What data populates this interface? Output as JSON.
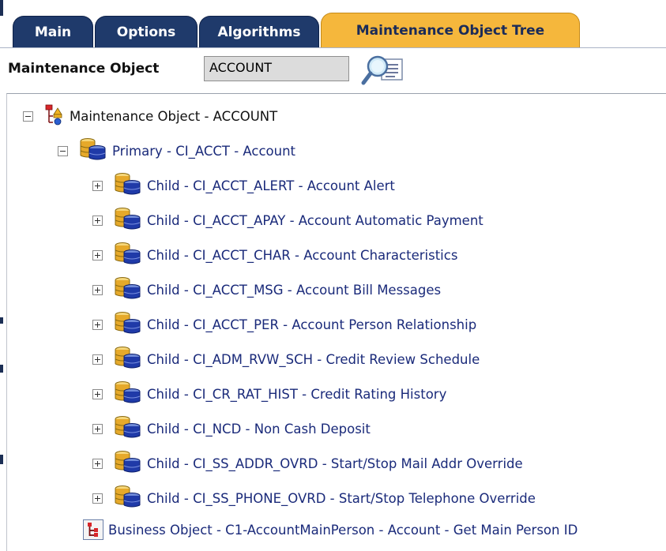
{
  "tabs": [
    {
      "label": "Main",
      "active": false
    },
    {
      "label": "Options",
      "active": false
    },
    {
      "label": "Algorithms",
      "active": false
    },
    {
      "label": "Maintenance Object Tree",
      "active": true
    }
  ],
  "maintenance_object": {
    "label": "Maintenance Object",
    "value": "ACCOUNT",
    "search_icon": "search-magnifier-icon"
  },
  "tree": {
    "root": {
      "label": "Maintenance Object - ACCOUNT",
      "icon": "maintenance-object-icon",
      "expanded": true
    },
    "primary": {
      "label": "Primary - CI_ACCT - Account",
      "icon": "database-table-icon",
      "expanded": true
    },
    "children": [
      {
        "label": "Child - CI_ACCT_ALERT - Account Alert"
      },
      {
        "label": "Child - CI_ACCT_APAY - Account Automatic Payment"
      },
      {
        "label": "Child - CI_ACCT_CHAR - Account Characteristics"
      },
      {
        "label": "Child - CI_ACCT_MSG - Account Bill Messages"
      },
      {
        "label": "Child - CI_ACCT_PER - Account Person Relationship"
      },
      {
        "label": "Child - CI_ADM_RVW_SCH - Credit Review Schedule"
      },
      {
        "label": "Child - CI_CR_RAT_HIST - Credit Rating History"
      },
      {
        "label": "Child - CI_NCD - Non Cash Deposit"
      },
      {
        "label": "Child - CI_SS_ADDR_OVRD - Start/Stop Mail Addr Override"
      },
      {
        "label": "Child - CI_SS_PHONE_OVRD - Start/Stop Telephone Override"
      }
    ],
    "business_object": {
      "label": "Business Object - C1-AccountMainPerson - Account - Get Main Person ID",
      "icon": "business-object-icon"
    }
  },
  "colors": {
    "tab_bg": "#1f3a6b",
    "tab_active_bg": "#f5b73c",
    "link_text": "#1a2a7a"
  }
}
